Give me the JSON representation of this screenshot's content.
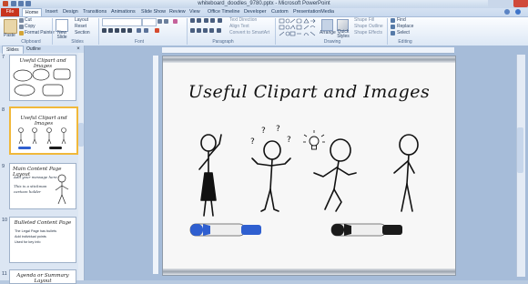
{
  "app": {
    "title": "whiteboard_doodles_9780.pptx - Microsoft PowerPoint"
  },
  "tabs": [
    "File",
    "Home",
    "Insert",
    "Design",
    "Transitions",
    "Animations",
    "Slide Show",
    "Review",
    "View",
    "Office Timeline",
    "Developer",
    "Custom",
    "PresentationMedia"
  ],
  "ribbon": {
    "clipboard": {
      "paste": "Paste",
      "cut": "Cut",
      "copy": "Copy",
      "format_painter": "Format Painter",
      "label": "Clipboard"
    },
    "slides": {
      "new_slide": "New Slide",
      "layout": "Layout",
      "reset": "Reset",
      "section": "Section",
      "label": "Slides"
    },
    "font": {
      "label": "Font"
    },
    "paragraph": {
      "text_direction": "Text Direction",
      "align_text": "Align Text",
      "convert_smartart": "Convert to SmartArt",
      "label": "Paragraph"
    },
    "drawing": {
      "arrange": "Arrange",
      "quick_styles": "Quick Styles",
      "shape_fill": "Shape Fill",
      "shape_outline": "Shape Outline",
      "shape_effects": "Shape Effects",
      "label": "Drawing"
    },
    "editing": {
      "find": "Find",
      "replace": "Replace",
      "select": "Select",
      "label": "Editing"
    }
  },
  "panel": {
    "tab_slides": "Slides",
    "tab_outline": "Outline",
    "slides": [
      {
        "num": "7",
        "title": "Useful Clipart and Images"
      },
      {
        "num": "8",
        "title": "Useful Clipart and Images"
      },
      {
        "num": "9",
        "title": "Main Content Page Layout",
        "body": [
          "Add your message here",
          "This is a stickman",
          "cartoon holder"
        ]
      },
      {
        "num": "10",
        "title": "Bulleted Content Page",
        "body": [
          "The Legal Page has bullets",
          "Add individual points",
          "Used for key info"
        ]
      },
      {
        "num": "11",
        "title": "Agenda or Summary Layout"
      }
    ]
  },
  "slide": {
    "title": "Useful Clipart and Images"
  },
  "colors": {
    "file_tab": "#c8341e",
    "ribbon_bg": "#dce7f5",
    "marker_blue": "#2f5fd0",
    "marker_black": "#1b1b1b"
  }
}
